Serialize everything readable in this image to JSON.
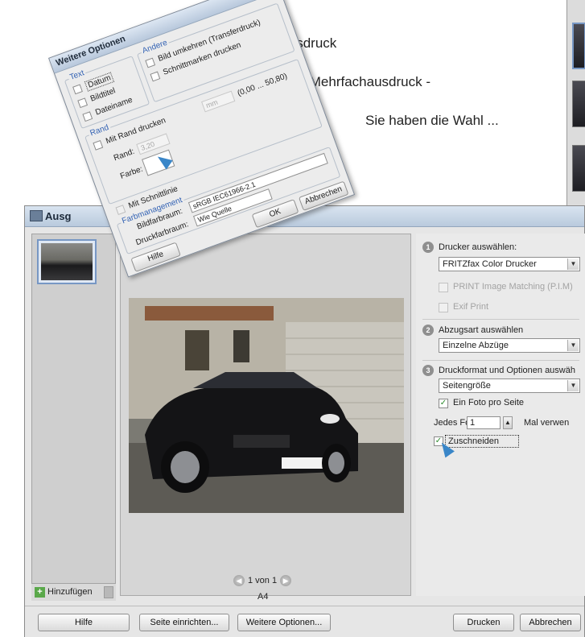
{
  "headline": {
    "line1": "Einzelausdruck",
    "line2": "oder Mehrfachausdruck -",
    "line3": "Sie haben die Wahl ..."
  },
  "main": {
    "title": "Ausg",
    "pager_text": "1 von 1",
    "paper_size": "A4",
    "add_label": "Hinzufügen",
    "steps": {
      "step1_num": "1",
      "step1_label": "Drucker auswählen:",
      "printer_value": "FRITZfax Color Drucker",
      "pim_label": "PRINT Image Matching (P.I.M)",
      "exif_label": "Exif Print",
      "step2_num": "2",
      "step2_label": "Abzugsart auswählen",
      "print_type_value": "Einzelne Abzüge",
      "step3_num": "3",
      "step3_label": "Druckformat und Optionen auswäh",
      "format_value": "Seitengröße",
      "one_photo_label": "Ein Foto pro Seite",
      "each_photo_label": "Jedes Foto",
      "each_photo_value": "1",
      "times_used_label": "Mal verwen",
      "crop_label": "Zuschneiden"
    },
    "buttons": {
      "help": "Hilfe",
      "page_setup": "Seite einrichten...",
      "more_options": "Weitere Optionen...",
      "print": "Drucken",
      "cancel": "Abbrechen"
    }
  },
  "options_dialog": {
    "title": "Weitere Optionen",
    "text_group": "Text",
    "date_label": "Datum",
    "image_title_label": "Bildtitel",
    "filename_label": "Dateiname",
    "other_group": "Andere",
    "flip_label": "Bild umkehren (Transferdruck)",
    "crop_marks_label": "Schnittmarken drucken",
    "border_group": "Rand",
    "with_border_label": "Mit Rand drucken",
    "unit_value": "mm",
    "range_text": "(0,00 ... 50,80)",
    "border_label": "Rand:",
    "border_value": "3,20",
    "color_label": "Farbe:",
    "cut_line_label": "Mit Schnittlinie",
    "color_mgmt_group": "Farbmanagement",
    "image_space_label": "Bildfarbraum:",
    "image_space_value": "sRGB IEC61966-2.1",
    "print_space_label": "Druckfarbraum:",
    "print_space_value": "Wie Quelle",
    "ok": "OK",
    "cancel": "Abbrechen",
    "help": "Hilfe"
  },
  "colors": {
    "accent": "#3a86c8",
    "check": "#2a8a2a"
  }
}
